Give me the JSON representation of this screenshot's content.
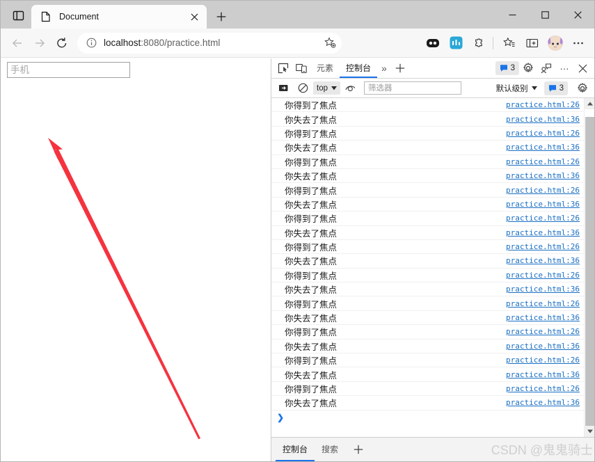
{
  "window": {
    "controls": {
      "minimize": "minimize-icon",
      "maximize": "maximize-icon",
      "close": "close-icon"
    }
  },
  "tabstrip": {
    "tab_search_icon": "tab-search-icon",
    "tabs": [
      {
        "title": "Document",
        "favicon": "page-icon",
        "active": true,
        "close_icon": "close-icon"
      }
    ],
    "new_tab_label": "+"
  },
  "toolbar": {
    "back_icon": "back-arrow-icon",
    "forward_icon": "forward-arrow-icon",
    "reload_icon": "reload-icon",
    "omnibox": {
      "info_icon": "info-icon",
      "url_host": "localhost",
      "url_rest": ":8080/practice.html",
      "url_full": "localhost:8080/practice.html",
      "favorite_icon": "add-favorite-star-icon"
    },
    "icons": [
      {
        "name": "split-screen-icon"
      },
      {
        "name": "app-icon"
      },
      {
        "name": "extensions-puzzle-icon"
      },
      {
        "name": "favorites-star-icon"
      },
      {
        "name": "collections-icon"
      },
      {
        "name": "profile-avatar"
      },
      {
        "name": "settings-more-icon",
        "label": "···"
      }
    ]
  },
  "page": {
    "phone_input": {
      "value": "",
      "placeholder": "手机"
    },
    "annotation_arrow": {
      "color": "#f5333f",
      "name": "red-pointer-arrow"
    }
  },
  "devtools": {
    "tabbar": {
      "inspect_icon": "inspect-element-icon",
      "device_icon": "device-toolbar-icon",
      "tabs": [
        {
          "label": "元素",
          "active": false
        },
        {
          "label": "控制台",
          "active": true
        }
      ],
      "overflow_label": "»",
      "add_tab_label": "+",
      "message_badge": "3",
      "settings_icon": "gear-icon",
      "feedback_icon": "feedback-icon",
      "more_label": "···",
      "close_icon": "close-icon"
    },
    "filterbar": {
      "clear_icon": "clear-console-icon",
      "no_entry_icon": "no-entry-icon",
      "context_value": "top",
      "eye_icon": "live-expression-eye-icon",
      "filter_placeholder": "筛选器",
      "filter_value": "",
      "level_value": "默认级别",
      "message_badge": "3",
      "settings_icon": "gear-icon"
    },
    "console": {
      "messages": [
        {
          "text": "你得到了焦点",
          "source": "practice.html:26"
        },
        {
          "text": "你失去了焦点",
          "source": "practice.html:36"
        },
        {
          "text": "你得到了焦点",
          "source": "practice.html:26"
        },
        {
          "text": "你失去了焦点",
          "source": "practice.html:36"
        },
        {
          "text": "你得到了焦点",
          "source": "practice.html:26"
        },
        {
          "text": "你失去了焦点",
          "source": "practice.html:36"
        },
        {
          "text": "你得到了焦点",
          "source": "practice.html:26"
        },
        {
          "text": "你失去了焦点",
          "source": "practice.html:36"
        },
        {
          "text": "你得到了焦点",
          "source": "practice.html:26"
        },
        {
          "text": "你失去了焦点",
          "source": "practice.html:36"
        },
        {
          "text": "你得到了焦点",
          "source": "practice.html:26"
        },
        {
          "text": "你失去了焦点",
          "source": "practice.html:36"
        },
        {
          "text": "你得到了焦点",
          "source": "practice.html:26"
        },
        {
          "text": "你失去了焦点",
          "source": "practice.html:36"
        },
        {
          "text": "你得到了焦点",
          "source": "practice.html:26"
        },
        {
          "text": "你失去了焦点",
          "source": "practice.html:36"
        },
        {
          "text": "你得到了焦点",
          "source": "practice.html:26"
        },
        {
          "text": "你失去了焦点",
          "source": "practice.html:36"
        },
        {
          "text": "你得到了焦点",
          "source": "practice.html:26"
        },
        {
          "text": "你失去了焦点",
          "source": "practice.html:36"
        },
        {
          "text": "你得到了焦点",
          "source": "practice.html:26"
        },
        {
          "text": "你失去了焦点",
          "source": "practice.html:36"
        }
      ],
      "prompt_caret": "❯",
      "prompt_value": ""
    },
    "drawer": {
      "tabs": [
        {
          "label": "控制台",
          "active": true
        },
        {
          "label": "搜索",
          "active": false
        }
      ],
      "add_label": "+",
      "watermark": "CSDN @鬼鬼骑士"
    }
  },
  "colors": {
    "accent_blue": "#1a73e8",
    "link_blue": "#1a6fc4",
    "arrow_red": "#f5333f",
    "chrome_gray": "#cdcdcd"
  }
}
